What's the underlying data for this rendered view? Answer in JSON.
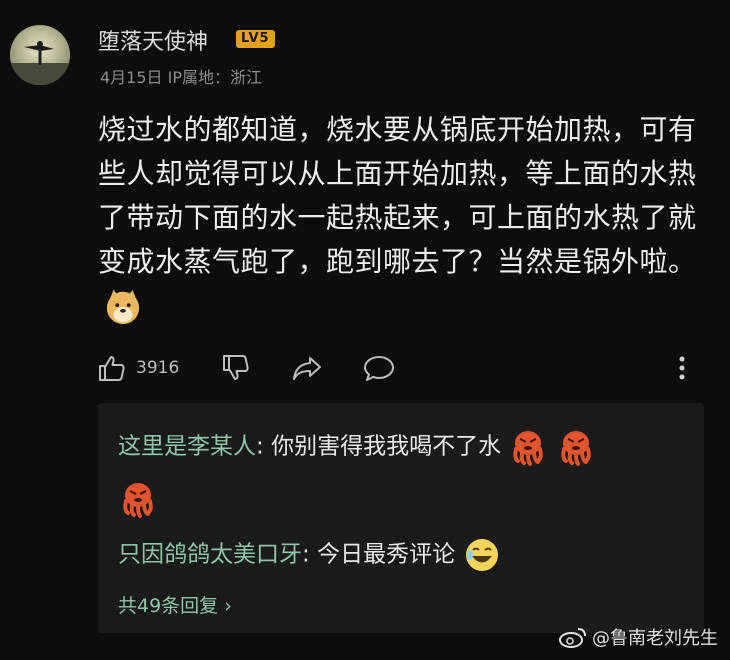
{
  "post": {
    "username": "堕落天使神",
    "level": "LV5",
    "date": "4月15日",
    "ip_location": "IP属地：浙江",
    "text": "烧过水的都知道，烧水要从锅底开始加热，可有些人却觉得可以从上面开始加热，等上面的水热了带动下面的水一起热起来，可上面的水热了就变成水蒸气跑了，跑到哪去了？当然是锅外啦。",
    "like_count": "3916"
  },
  "replies": {
    "items": [
      {
        "name": "这里是李某人",
        "text": "你别害得我我喝不了水"
      },
      {
        "name": "只因鸽鸽太美口牙",
        "text": "今日最秀评论"
      }
    ],
    "more_label": "共49条回复 ›"
  },
  "watermark": {
    "text": "@鲁南老刘先生"
  },
  "colors": {
    "background": "#0d0d0d",
    "reply_name": "#8cc6a6",
    "level_badge": "#e3a21b"
  }
}
